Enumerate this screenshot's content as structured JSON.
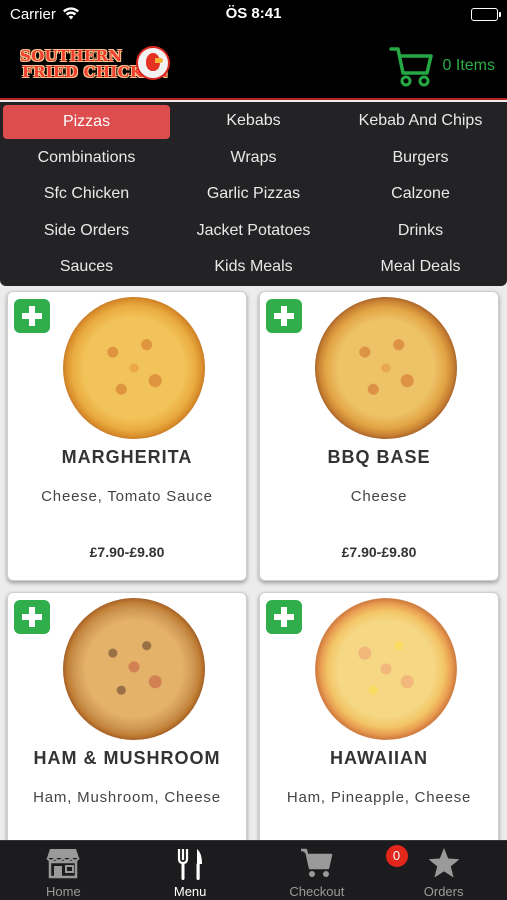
{
  "status_bar": {
    "carrier": "Carrier",
    "time": "ÖS 8:41"
  },
  "header": {
    "logo_line1": "SOUTHERN",
    "logo_line2": "FRIED CHICKEN",
    "cart_label": "0 Items"
  },
  "categories": [
    {
      "label": "Pizzas",
      "active": true
    },
    {
      "label": "Kebabs"
    },
    {
      "label": "Kebab And Chips"
    },
    {
      "label": "Combinations"
    },
    {
      "label": "Wraps"
    },
    {
      "label": "Burgers"
    },
    {
      "label": "Sfc Chicken"
    },
    {
      "label": "Garlic Pizzas"
    },
    {
      "label": "Calzone"
    },
    {
      "label": "Side Orders"
    },
    {
      "label": "Jacket Potatoes"
    },
    {
      "label": "Drinks"
    },
    {
      "label": "Sauces"
    },
    {
      "label": "Kids Meals"
    },
    {
      "label": "Meal Deals"
    }
  ],
  "products": [
    {
      "name": "MARGHERITA",
      "description": "Cheese, Tomato Sauce",
      "price": "£7.90-£9.80"
    },
    {
      "name": "BBQ BASE",
      "description": "Cheese",
      "price": "£7.90-£9.80"
    },
    {
      "name": "HAM & MUSHROOM",
      "description": "Ham, Mushroom, Cheese",
      "price": ""
    },
    {
      "name": "HAWAIIAN",
      "description": "Ham, Pineapple, Cheese",
      "price": ""
    }
  ],
  "tabbar": {
    "tabs": [
      {
        "label": "Home",
        "icon": "store-icon"
      },
      {
        "label": "Menu",
        "icon": "fork-knife-icon",
        "active": true
      },
      {
        "label": "Checkout",
        "icon": "cart-icon",
        "badge": "0"
      },
      {
        "label": "Orders",
        "icon": "star-icon"
      }
    ]
  },
  "colors": {
    "accent_red": "#dd4d4d",
    "cart_green": "#2cae48",
    "add_green": "#2fae4b",
    "badge_red": "#e2261c"
  }
}
